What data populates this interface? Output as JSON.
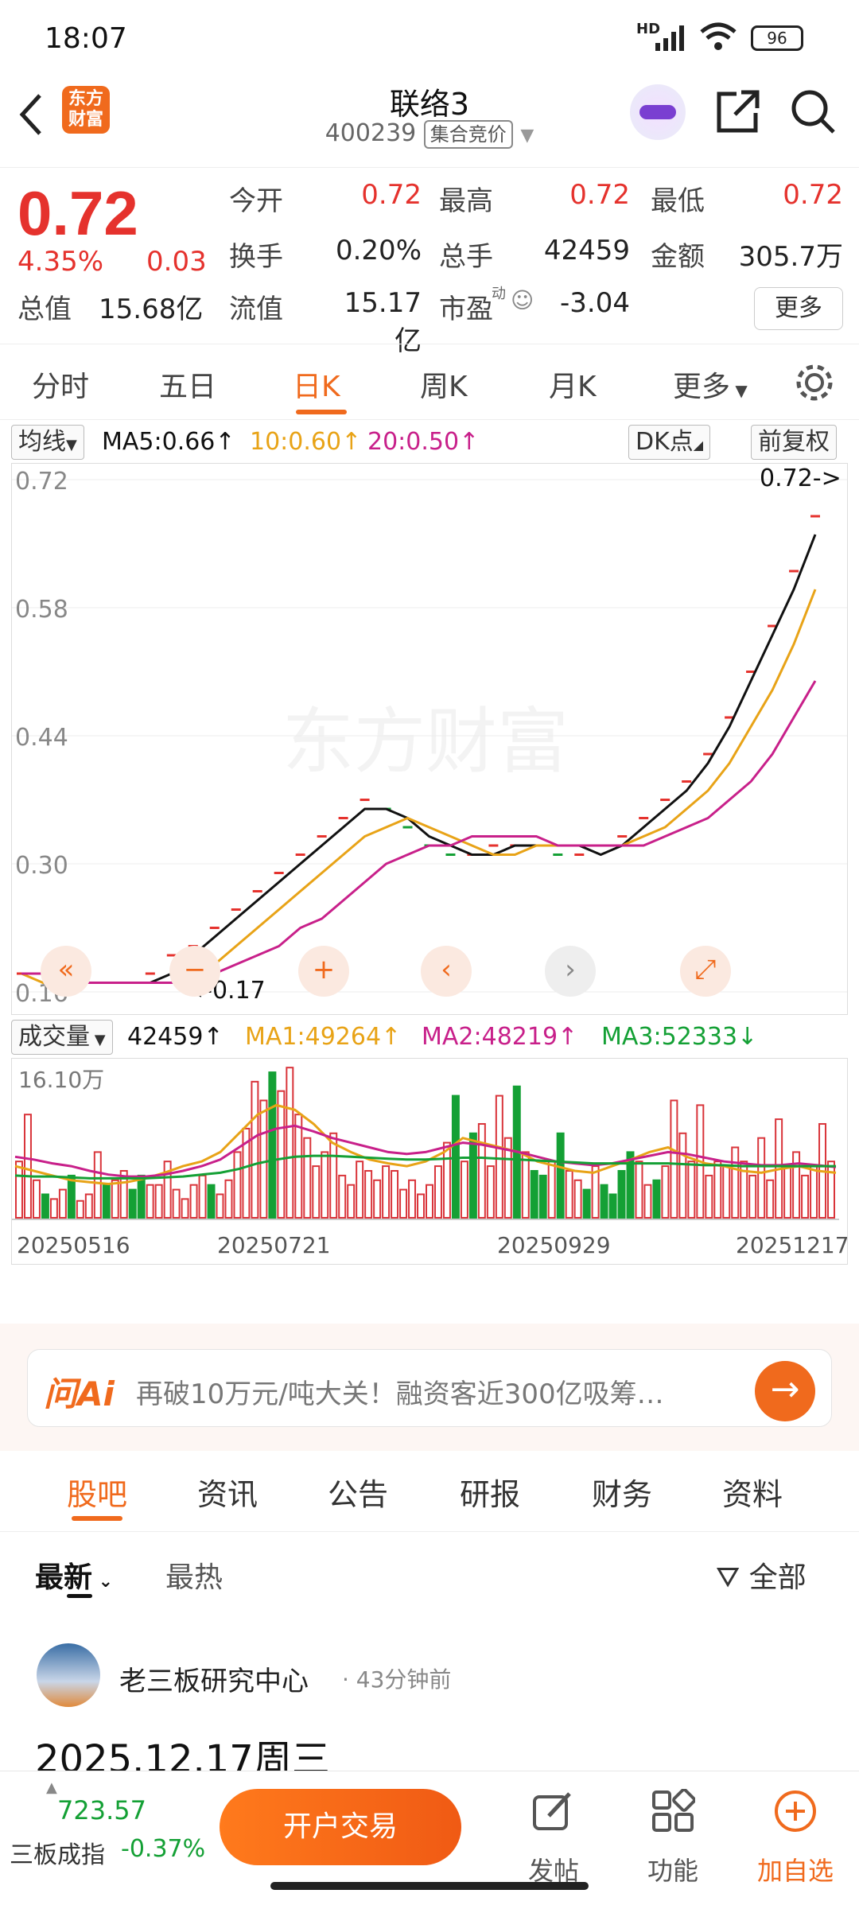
{
  "status_bar": {
    "time": "18:07",
    "network": "HD",
    "battery": "96"
  },
  "header": {
    "back_icon": "chevron-left-icon",
    "logo_text": "东方财富",
    "title": "联络3",
    "code": "400239",
    "mode_tag": "集合竞价",
    "share_icon": "share-icon",
    "search_icon": "search-icon"
  },
  "quote": {
    "price": "0.72",
    "change_pct": "4.35%",
    "change": "0.03",
    "open_label": "今开",
    "open": "0.72",
    "high_label": "最高",
    "high": "0.72",
    "low_label": "最低",
    "low": "0.72",
    "turnover_label": "换手",
    "turnover": "0.20%",
    "volume_label": "总手",
    "volume": "42459",
    "amount_label": "金额",
    "amount": "305.7万",
    "mktcap_label": "总值",
    "mktcap": "15.68亿",
    "float_label": "流值",
    "float": "15.17亿",
    "pe_label": "市盈",
    "pe_sup": "动",
    "pe": "-3.04",
    "more": "更多"
  },
  "period_tabs": [
    "分时",
    "五日",
    "日K",
    "周K",
    "月K",
    "更多"
  ],
  "period_active": 2,
  "ma_legend": {
    "type_btn": "均线",
    "ma5": "MA5:0.66",
    "ma10": "10:0.60",
    "ma20": "20:0.50",
    "dk_btn": "DK点",
    "adjust_btn": "前复权"
  },
  "vol_legend": {
    "type_btn": "成交量",
    "vol": "42459",
    "ma1": "MA1:49264",
    "ma2": "MA2:48219",
    "ma3": "MA3:52333"
  },
  "chart_data": [
    {
      "type": "line",
      "title": "",
      "y_ticks": [
        "0.72",
        "0.58",
        "0.44",
        "0.30",
        "0.16"
      ],
      "ylim": [
        0.16,
        0.72
      ],
      "watermark": "东方财富",
      "last_price_label": "0.72->",
      "low_marker_label": "<-0.17",
      "colors": {
        "ma5": "#111111",
        "ma10": "#e8a317",
        "ma20": "#c8208a",
        "up": "#e5322d",
        "down": "#14a035"
      },
      "series": [
        {
          "name": "MA5",
          "values": [
            0.18,
            0.18,
            0.17,
            0.17,
            0.17,
            0.17,
            0.17,
            0.18,
            0.2,
            0.22,
            0.24,
            0.26,
            0.28,
            0.3,
            0.32,
            0.34,
            0.36,
            0.36,
            0.35,
            0.33,
            0.32,
            0.31,
            0.31,
            0.32,
            0.32,
            0.32,
            0.32,
            0.31,
            0.32,
            0.34,
            0.36,
            0.38,
            0.41,
            0.45,
            0.5,
            0.55,
            0.6,
            0.66
          ]
        },
        {
          "name": "MA10",
          "values": [
            0.18,
            0.17,
            0.17,
            0.17,
            0.17,
            0.17,
            0.17,
            0.17,
            0.18,
            0.19,
            0.21,
            0.23,
            0.25,
            0.27,
            0.29,
            0.31,
            0.33,
            0.34,
            0.35,
            0.34,
            0.33,
            0.32,
            0.31,
            0.31,
            0.32,
            0.32,
            0.32,
            0.32,
            0.32,
            0.33,
            0.34,
            0.36,
            0.38,
            0.41,
            0.45,
            0.49,
            0.54,
            0.6
          ]
        },
        {
          "name": "MA20",
          "values": [
            0.18,
            0.18,
            0.17,
            0.17,
            0.17,
            0.17,
            0.17,
            0.17,
            0.17,
            0.18,
            0.19,
            0.2,
            0.21,
            0.23,
            0.24,
            0.26,
            0.28,
            0.3,
            0.31,
            0.32,
            0.32,
            0.33,
            0.33,
            0.33,
            0.33,
            0.32,
            0.32,
            0.32,
            0.32,
            0.32,
            0.33,
            0.34,
            0.35,
            0.37,
            0.39,
            0.42,
            0.46,
            0.5
          ]
        }
      ],
      "close_marks": [
        0.18,
        0.18,
        0.17,
        0.17,
        0.17,
        0.17,
        0.18,
        0.2,
        0.21,
        0.23,
        0.25,
        0.27,
        0.29,
        0.31,
        0.33,
        0.35,
        0.37,
        0.36,
        0.34,
        0.32,
        0.31,
        0.31,
        0.32,
        0.32,
        0.32,
        0.31,
        0.31,
        0.32,
        0.33,
        0.35,
        0.37,
        0.39,
        0.42,
        0.46,
        0.51,
        0.56,
        0.62,
        0.68
      ]
    },
    {
      "type": "bar",
      "title": "",
      "y_ticks": [
        "16.10万"
      ],
      "ylim": [
        0,
        161000
      ],
      "x_ticks": [
        "20250516",
        "20250721",
        "20250929",
        "20251217"
      ],
      "volumes": [
        60,
        110,
        40,
        25,
        20,
        30,
        45,
        18,
        25,
        70,
        35,
        40,
        50,
        30,
        45,
        35,
        35,
        60,
        30,
        20,
        35,
        45,
        35,
        25,
        40,
        70,
        95,
        145,
        125,
        155,
        135,
        160,
        110,
        85,
        55,
        70,
        90,
        45,
        35,
        60,
        50,
        40,
        55,
        50,
        30,
        40,
        25,
        35,
        55,
        80,
        130,
        60,
        90,
        100,
        55,
        130,
        85,
        140,
        70,
        50,
        45,
        60,
        90,
        50,
        40,
        30,
        55,
        35,
        25,
        50,
        70,
        60,
        35,
        40,
        55,
        125,
        90,
        60,
        120,
        45,
        60,
        55,
        75,
        60,
        45,
        85,
        40,
        105,
        55,
        70,
        45,
        55,
        100,
        60
      ],
      "down_bars": [
        3,
        6,
        10,
        13,
        14,
        22,
        29,
        50,
        52,
        57,
        59,
        60,
        62,
        65,
        67,
        68,
        69,
        70,
        73
      ],
      "series": [
        {
          "name": "MA1",
          "values": [
            55,
            50,
            45,
            40,
            38,
            36,
            38,
            42,
            48,
            55,
            60,
            70,
            90,
            110,
            120,
            115,
            100,
            80,
            70,
            62,
            58,
            55,
            60,
            70,
            85,
            80,
            75,
            70,
            60,
            55,
            50,
            48,
            55,
            62,
            70,
            75,
            65,
            58,
            55,
            50,
            48,
            52,
            55,
            50,
            48
          ]
        },
        {
          "name": "MA2",
          "values": [
            65,
            62,
            58,
            55,
            50,
            46,
            44,
            44,
            46,
            50,
            55,
            62,
            75,
            88,
            95,
            98,
            92,
            85,
            80,
            75,
            70,
            68,
            70,
            75,
            80,
            78,
            74,
            70,
            65,
            60,
            58,
            56,
            58,
            62,
            66,
            70,
            68,
            64,
            60,
            58,
            56,
            56,
            58,
            56,
            54
          ]
        },
        {
          "name": "MA3",
          "values": [
            45,
            44,
            44,
            43,
            42,
            42,
            42,
            42,
            43,
            44,
            46,
            48,
            52,
            58,
            62,
            65,
            66,
            66,
            65,
            64,
            63,
            62,
            62,
            63,
            64,
            64,
            63,
            62,
            61,
            60,
            59,
            58,
            58,
            58,
            58,
            58,
            57,
            56,
            56,
            55,
            55,
            55,
            55,
            55,
            55
          ]
        }
      ]
    }
  ],
  "ai_banner": {
    "logo": "问Ai",
    "text": "再破10万元/吨大关！融资客近300亿吸筹…",
    "go_icon": "arrow-right-icon"
  },
  "bottom_tabs": [
    "股吧",
    "资讯",
    "公告",
    "研报",
    "财务",
    "资料"
  ],
  "bottom_active": 0,
  "feed": {
    "sort_new": "最新",
    "sort_hot": "最热",
    "filter": "全部",
    "post": {
      "author": "老三板研究中心",
      "time": "· 43分钟前",
      "title": "2025.12.17周三"
    }
  },
  "bottom_bar": {
    "index_value": "723.57",
    "index_name": "三板成指",
    "index_change": "-0.37%",
    "trade_btn": "开户交易",
    "post_label": "发帖",
    "func_label": "功能",
    "watch_label": "加自选"
  }
}
